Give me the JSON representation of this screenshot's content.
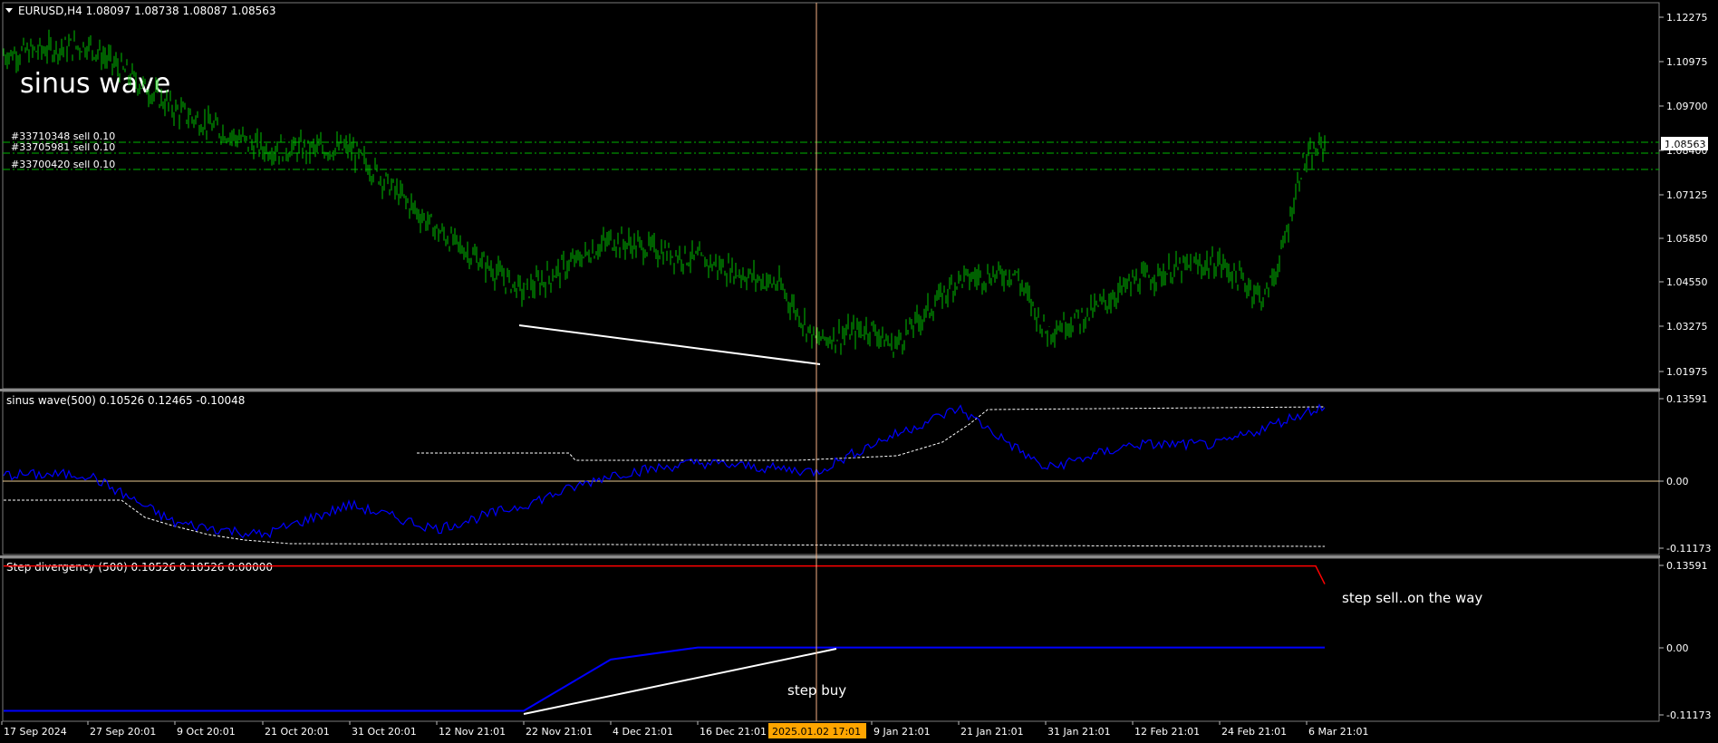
{
  "symbol_header": "EURUSD,H4  1.08097 1.08738 1.08087 1.08563",
  "annotation_title": "sinus wave",
  "colors": {
    "background": "#000000",
    "candles": "#00c000",
    "grid_separator": "#8c8c8c",
    "crosshair": "#f4b183",
    "order_line": "#00b400",
    "indicator_main": "#0000ff",
    "indicator_level": "#ffffff",
    "step_sell_line": "#ff0000",
    "step_buy_line": "#0000ff",
    "zero_line": "#e9c98f",
    "date_highlight": "#ffa500"
  },
  "orders": [
    {
      "label": "#33710348 sell 0.10",
      "price": 1.0856
    },
    {
      "label": "#33705981 sell 0.10",
      "price": 1.084
    },
    {
      "label": "#33700420 sell 0.10",
      "price": 1.08
    }
  ],
  "current_price_label": "1.08563",
  "annotations": {
    "step_sell": "step sell..on the way",
    "step_buy": "step buy"
  },
  "panels": [
    {
      "id": "price",
      "title": "",
      "y_ticks": [
        "1.12275",
        "1.10975",
        "1.09700",
        "1.08400",
        "1.07125",
        "1.05850",
        "1.04550",
        "1.03275",
        "1.01975"
      ]
    },
    {
      "id": "sinus",
      "title": "sinus wave(500) 0.10526 0.12465 -0.10048",
      "y_ticks": [
        "0.13591",
        "0.00",
        "-0.11173"
      ]
    },
    {
      "id": "step",
      "title": "Step divergency (500) 0.10526 0.10526 0.00000",
      "y_ticks": [
        "0.13591",
        "0.00",
        "-0.11173"
      ]
    }
  ],
  "x_ticks": [
    "17 Sep 2024",
    "27 Sep 20:01",
    "9 Oct 20:01",
    "21 Oct 20:01",
    "31 Oct 20:01",
    "12 Nov 21:01",
    "22 Nov 21:01",
    "4 Dec 21:01",
    "16 Dec 21:01",
    "9 Jan 21:01",
    "21 Jan 21:01",
    "31 Jan 21:01",
    "12 Feb 21:01",
    "24 Feb 21:01",
    "6 Mar 21:01"
  ],
  "crosshair_date": "2025.01.02 17:01",
  "chart_data": [
    {
      "type": "line",
      "title": "EURUSD,H4",
      "series": [
        {
          "name": "EURUSD",
          "x": [
            "17 Sep 2024",
            "27 Sep",
            "9 Oct",
            "21 Oct",
            "31 Oct",
            "5 Nov",
            "12 Nov",
            "22 Nov",
            "4 Dec",
            "16 Dec",
            "24 Dec",
            "2 Jan",
            "9 Jan",
            "13 Jan",
            "21 Jan",
            "27 Jan",
            "31 Jan",
            "5 Feb",
            "12 Feb",
            "18 Feb",
            "24 Feb",
            "28 Feb",
            "3 Mar",
            "6 Mar",
            "7 Mar"
          ],
          "values": [
            1.113,
            1.116,
            1.096,
            1.084,
            1.084,
            1.078,
            1.059,
            1.04,
            1.056,
            1.05,
            1.042,
            1.025,
            1.029,
            1.023,
            1.044,
            1.046,
            1.028,
            1.033,
            1.043,
            1.047,
            1.049,
            1.038,
            1.05,
            1.079,
            1.0856
          ]
        }
      ],
      "ylim": [
        1.015,
        1.127
      ]
    },
    {
      "type": "line",
      "title": "sinus wave(500) 0.10526 0.12465 -0.10048",
      "series": [
        {
          "name": "sinus wave",
          "x": [
            "17 Sep 2024",
            "27 Sep",
            "9 Oct",
            "21 Oct",
            "31 Oct",
            "12 Nov",
            "22 Nov",
            "4 Dec",
            "16 Dec",
            "2 Jan",
            "9 Jan",
            "21 Jan",
            "31 Jan",
            "12 Feb",
            "24 Feb",
            "6 Mar"
          ],
          "values": [
            0.01,
            0.01,
            -0.07,
            -0.09,
            -0.04,
            -0.08,
            -0.04,
            0.01,
            0.03,
            0.015,
            0.06,
            0.12,
            0.02,
            0.06,
            0.06,
            0.125
          ]
        }
      ],
      "ylim": [
        -0.11173,
        0.13591
      ]
    },
    {
      "type": "line",
      "title": "Step divergency (500) 0.10526 0.10526 0.00000",
      "series": [
        {
          "name": "step sell",
          "x": [
            "17 Sep 2024",
            "6 Mar",
            "7 Mar"
          ],
          "values": [
            0.135,
            0.135,
            0.105
          ]
        },
        {
          "name": "step buy",
          "x": [
            "17 Sep 2024",
            "22 Nov",
            "4 Dec",
            "16 Dec",
            "2 Jan",
            "7 Mar"
          ],
          "values": [
            -0.105,
            -0.105,
            -0.02,
            0.0,
            0.0,
            0.0
          ]
        }
      ],
      "ylim": [
        -0.11173,
        0.13591
      ]
    }
  ]
}
